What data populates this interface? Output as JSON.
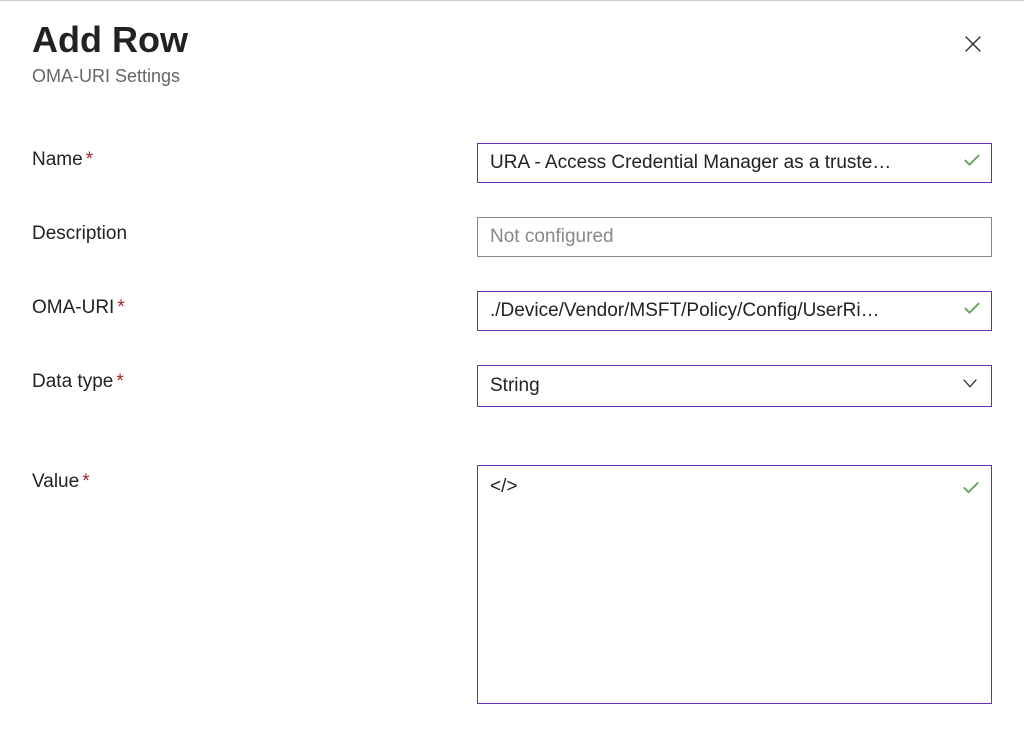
{
  "header": {
    "title": "Add Row",
    "subtitle": "OMA-URI Settings"
  },
  "form": {
    "name": {
      "label": "Name",
      "required": true,
      "value": "URA - Access Credential Manager as a truste…",
      "validated": true
    },
    "description": {
      "label": "Description",
      "required": false,
      "placeholder": "Not configured",
      "value": ""
    },
    "omaUri": {
      "label": "OMA-URI",
      "required": true,
      "value": "./Device/Vendor/MSFT/Policy/Config/UserRi…",
      "validated": true
    },
    "dataType": {
      "label": "Data type",
      "required": true,
      "selected": "String"
    },
    "value": {
      "label": "Value",
      "required": true,
      "value": "</>",
      "validated": true
    }
  },
  "requiredMark": "*"
}
